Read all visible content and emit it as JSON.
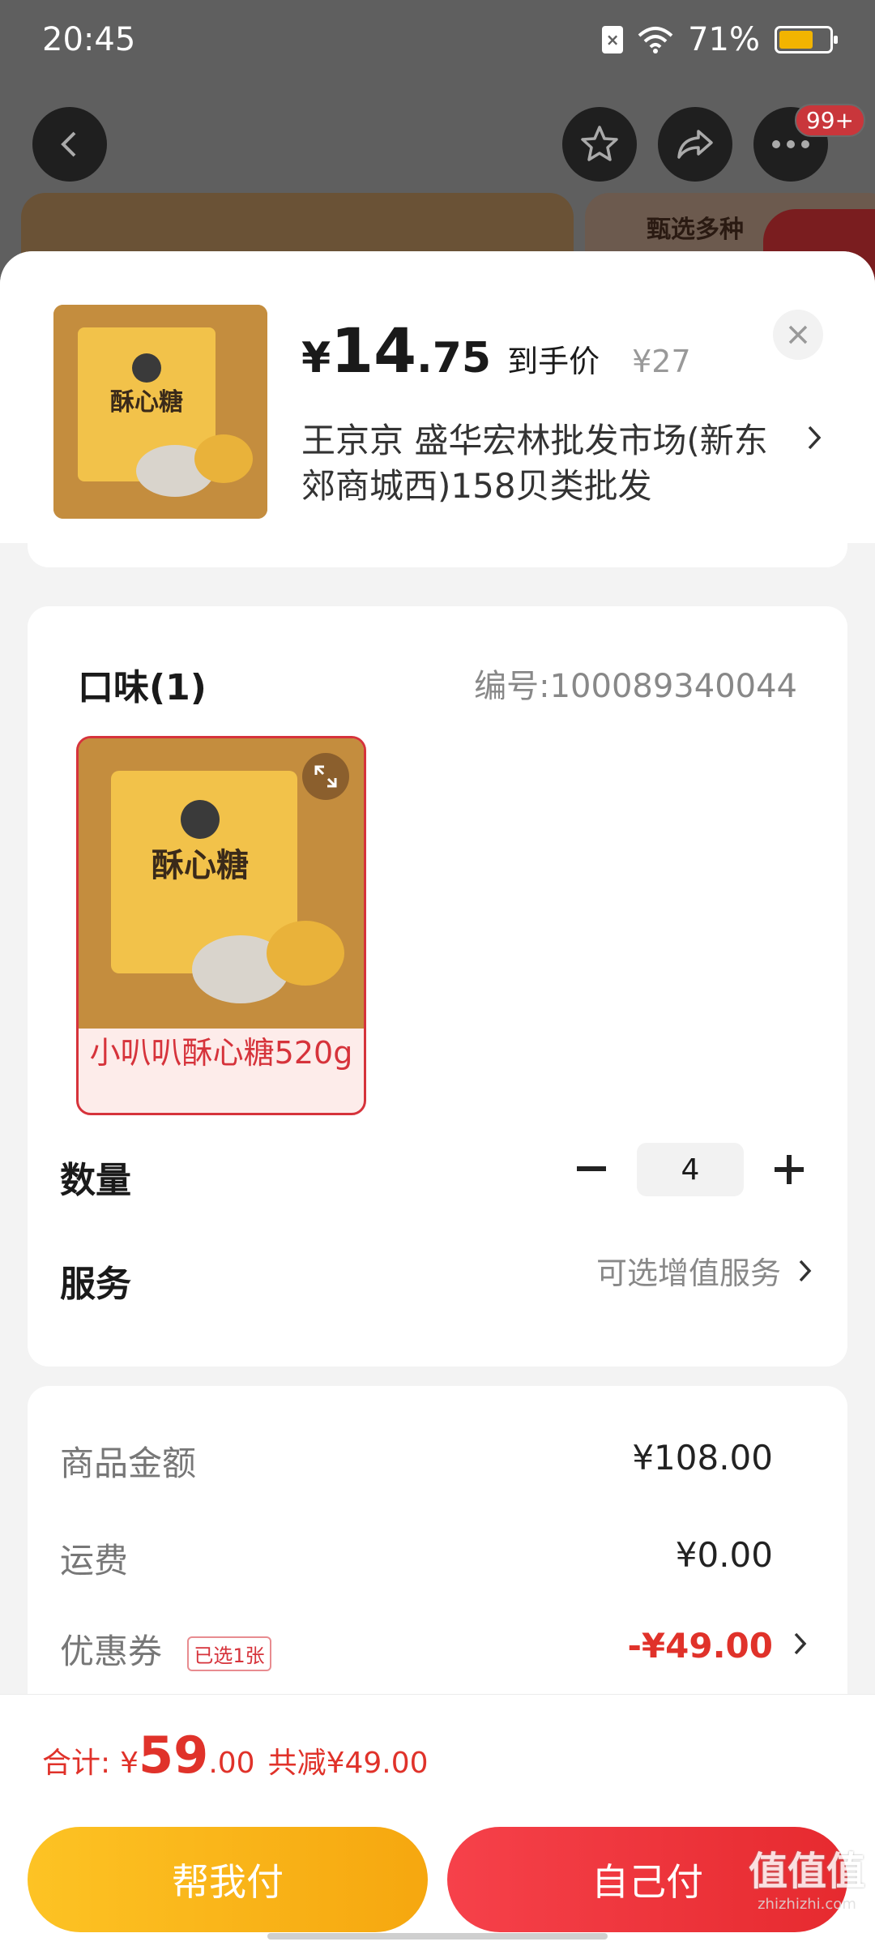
{
  "status_bar": {
    "time": "20:45",
    "battery": "71%",
    "battery_level": 0.71
  },
  "header": {
    "cart_badge": "99+",
    "bg_card_text": "甄选多种"
  },
  "product": {
    "price_symbol": "¥",
    "price_int": "14",
    "price_dec": ".75",
    "price_tag": "到手价",
    "original_price": "¥27",
    "shop_name": "王京京  盛华宏林批发市场(新东郊商城西)158贝类批发",
    "image_title": "酥心糖"
  },
  "options": {
    "title": "口味(1)",
    "sku": "编号:100089340044",
    "items": [
      {
        "name": "小叭叭酥心糖520g",
        "selected": true
      }
    ]
  },
  "quantity": {
    "label": "数量",
    "value": "4"
  },
  "service": {
    "label": "服务",
    "hint": "可选增值服务"
  },
  "summary": {
    "goods_label": "商品金额",
    "goods_value": "¥108.00",
    "shipping_label": "运费",
    "shipping_value": "¥0.00",
    "coupon_label": "优惠券",
    "coupon_tag": "已选1张",
    "coupon_value": "-¥49.00"
  },
  "footer": {
    "total_label": "合计:",
    "total_symbol": "¥",
    "total_int": "59",
    "total_dec": ".00",
    "total_reduce": "共减¥49.00",
    "help_pay": "帮我付",
    "self_pay": "自己付"
  },
  "watermark": {
    "main": "值值值",
    "sub": "zhizhizhi.com"
  },
  "colors": {
    "accent_red": "#e0322a",
    "help_pay_yellow": "#f6a70f",
    "self_pay_red": "#e62a2f"
  }
}
